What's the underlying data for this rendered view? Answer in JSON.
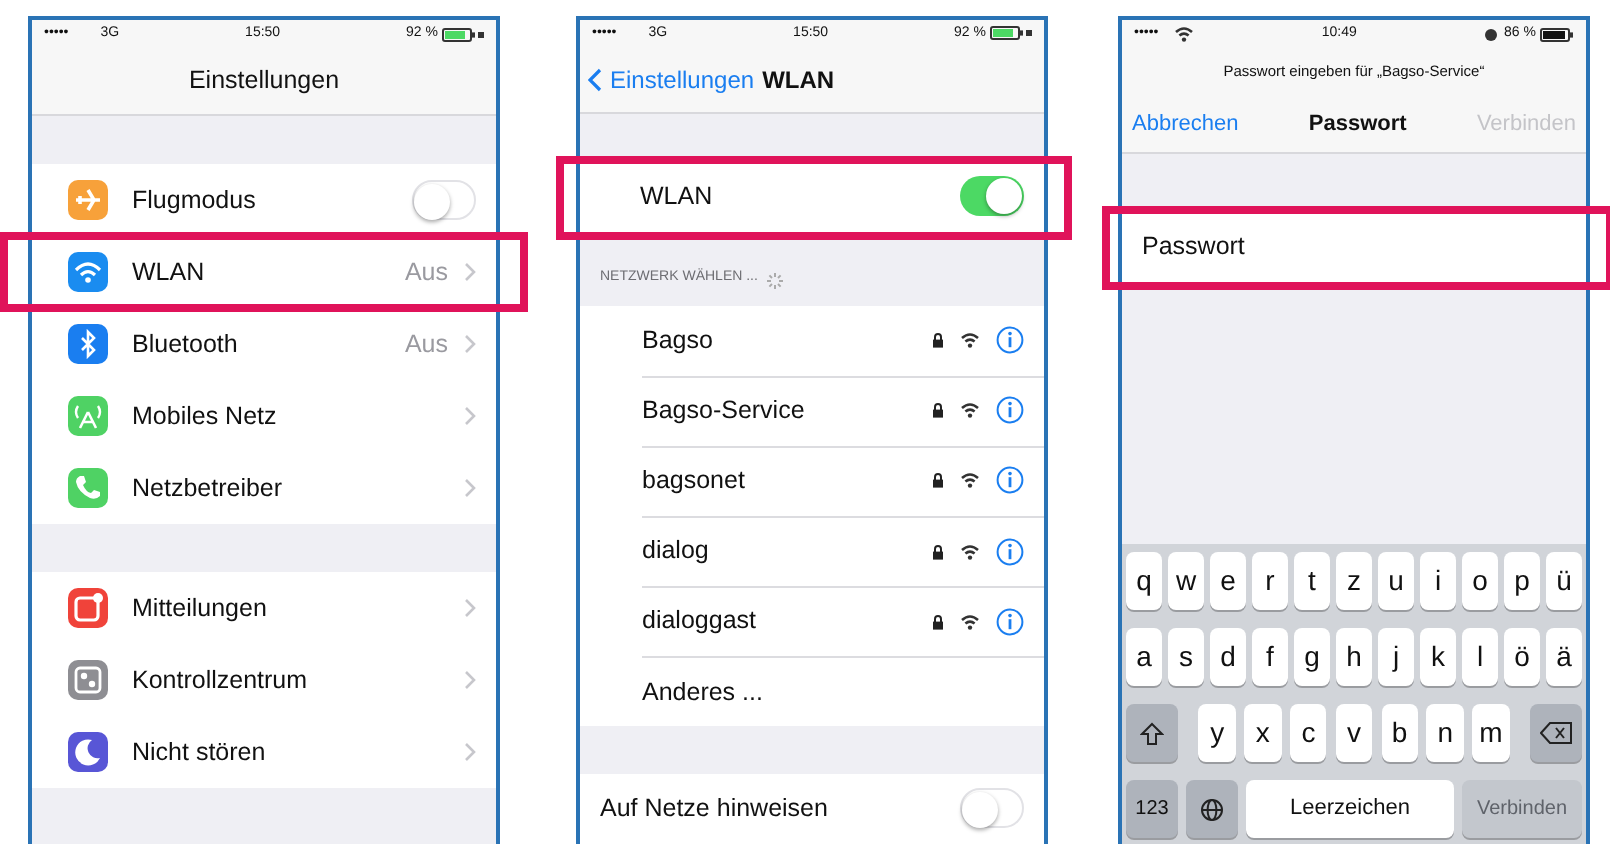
{
  "settings_screen": {
    "status": {
      "signal": "•••••",
      "network": "3G",
      "time": "15:50",
      "battery": "92 %",
      "charging": true
    },
    "title": "Einstellungen",
    "groups": [
      [
        {
          "label": "Flugmodus",
          "kind": "switch",
          "on": false,
          "color": "#f7a13a",
          "highlighted": false
        },
        {
          "label": "WLAN",
          "kind": "link",
          "value": "Aus",
          "color": "#1a8cf0",
          "highlighted": true
        },
        {
          "label": "Bluetooth",
          "kind": "link",
          "value": "Aus",
          "color": "#1a7ef0",
          "highlighted": false
        },
        {
          "label": "Mobiles Netz",
          "kind": "link",
          "color": "#4fd264",
          "highlighted": false
        },
        {
          "label": "Netzbetreiber",
          "kind": "link",
          "color": "#4fd264",
          "highlighted": false
        }
      ],
      [
        {
          "label": "Mitteilungen",
          "kind": "link",
          "color": "#f0433a",
          "highlighted": false
        },
        {
          "label": "Kontrollzentrum",
          "kind": "link",
          "color": "#8e8e93",
          "highlighted": false
        },
        {
          "label": "Nicht stören",
          "kind": "link",
          "color": "#5856d6",
          "highlighted": false
        }
      ]
    ]
  },
  "wlan_screen": {
    "status": {
      "signal": "•••••",
      "network": "3G",
      "time": "15:50",
      "battery": "92 %",
      "charging": true
    },
    "back": "Einstellungen",
    "title": "WLAN",
    "wlan_row": {
      "label": "WLAN",
      "on": true,
      "highlighted": true
    },
    "section_header": "NETZWERK WÄHLEN ...",
    "networks": [
      {
        "name": "Bagso",
        "kind": "network",
        "locked": true
      },
      {
        "name": "Bagso-Service",
        "kind": "network",
        "locked": true
      },
      {
        "name": "bagsonet",
        "kind": "network",
        "locked": true
      },
      {
        "name": "dialog",
        "kind": "network",
        "locked": true
      },
      {
        "name": "dialoggast",
        "kind": "network",
        "locked": true
      },
      {
        "name": "Anderes ...",
        "kind": "other"
      }
    ],
    "ask_row": {
      "label": "Auf Netze hinweisen",
      "on": false
    }
  },
  "password_screen": {
    "status": {
      "signal": "•••••",
      "time": "10:49",
      "battery": "86 %",
      "charging": false
    },
    "prompt": "Passwort eingeben für „Bagso-Service“",
    "nav": {
      "cancel": {
        "label": "Abbrechen",
        "disabled": false
      },
      "title": "Passwort",
      "confirm": {
        "label": "Verbinden",
        "disabled": true
      }
    },
    "field": {
      "label": "Passwort",
      "highlighted": true
    },
    "keyboard": [
      [
        {
          "kind": "letter",
          "label": "q"
        },
        {
          "kind": "letter",
          "label": "w"
        },
        {
          "kind": "letter",
          "label": "e"
        },
        {
          "kind": "letter",
          "label": "r"
        },
        {
          "kind": "letter",
          "label": "t"
        },
        {
          "kind": "letter",
          "label": "z"
        },
        {
          "kind": "letter",
          "label": "u"
        },
        {
          "kind": "letter",
          "label": "i"
        },
        {
          "kind": "letter",
          "label": "o"
        },
        {
          "kind": "letter",
          "label": "p"
        },
        {
          "kind": "letter",
          "label": "ü"
        }
      ],
      [
        {
          "kind": "letter",
          "label": "a"
        },
        {
          "kind": "letter",
          "label": "s"
        },
        {
          "kind": "letter",
          "label": "d"
        },
        {
          "kind": "letter",
          "label": "f"
        },
        {
          "kind": "letter",
          "label": "g"
        },
        {
          "kind": "letter",
          "label": "h"
        },
        {
          "kind": "letter",
          "label": "j"
        },
        {
          "kind": "letter",
          "label": "k"
        },
        {
          "kind": "letter",
          "label": "l"
        },
        {
          "kind": "letter",
          "label": "ö"
        },
        {
          "kind": "letter",
          "label": "ä"
        }
      ],
      [
        {
          "kind": "shift"
        },
        {
          "kind": "letter",
          "label": "y"
        },
        {
          "kind": "letter",
          "label": "x"
        },
        {
          "kind": "letter",
          "label": "c"
        },
        {
          "kind": "letter",
          "label": "v"
        },
        {
          "kind": "letter",
          "label": "b"
        },
        {
          "kind": "letter",
          "label": "n"
        },
        {
          "kind": "letter",
          "label": "m"
        },
        {
          "kind": "delete"
        }
      ],
      [
        {
          "kind": "mode",
          "label": "123"
        },
        {
          "kind": "globe"
        },
        {
          "kind": "space",
          "label": "Leerzeichen"
        },
        {
          "kind": "return",
          "label": "Verbinden",
          "disabled": true
        }
      ]
    ]
  }
}
